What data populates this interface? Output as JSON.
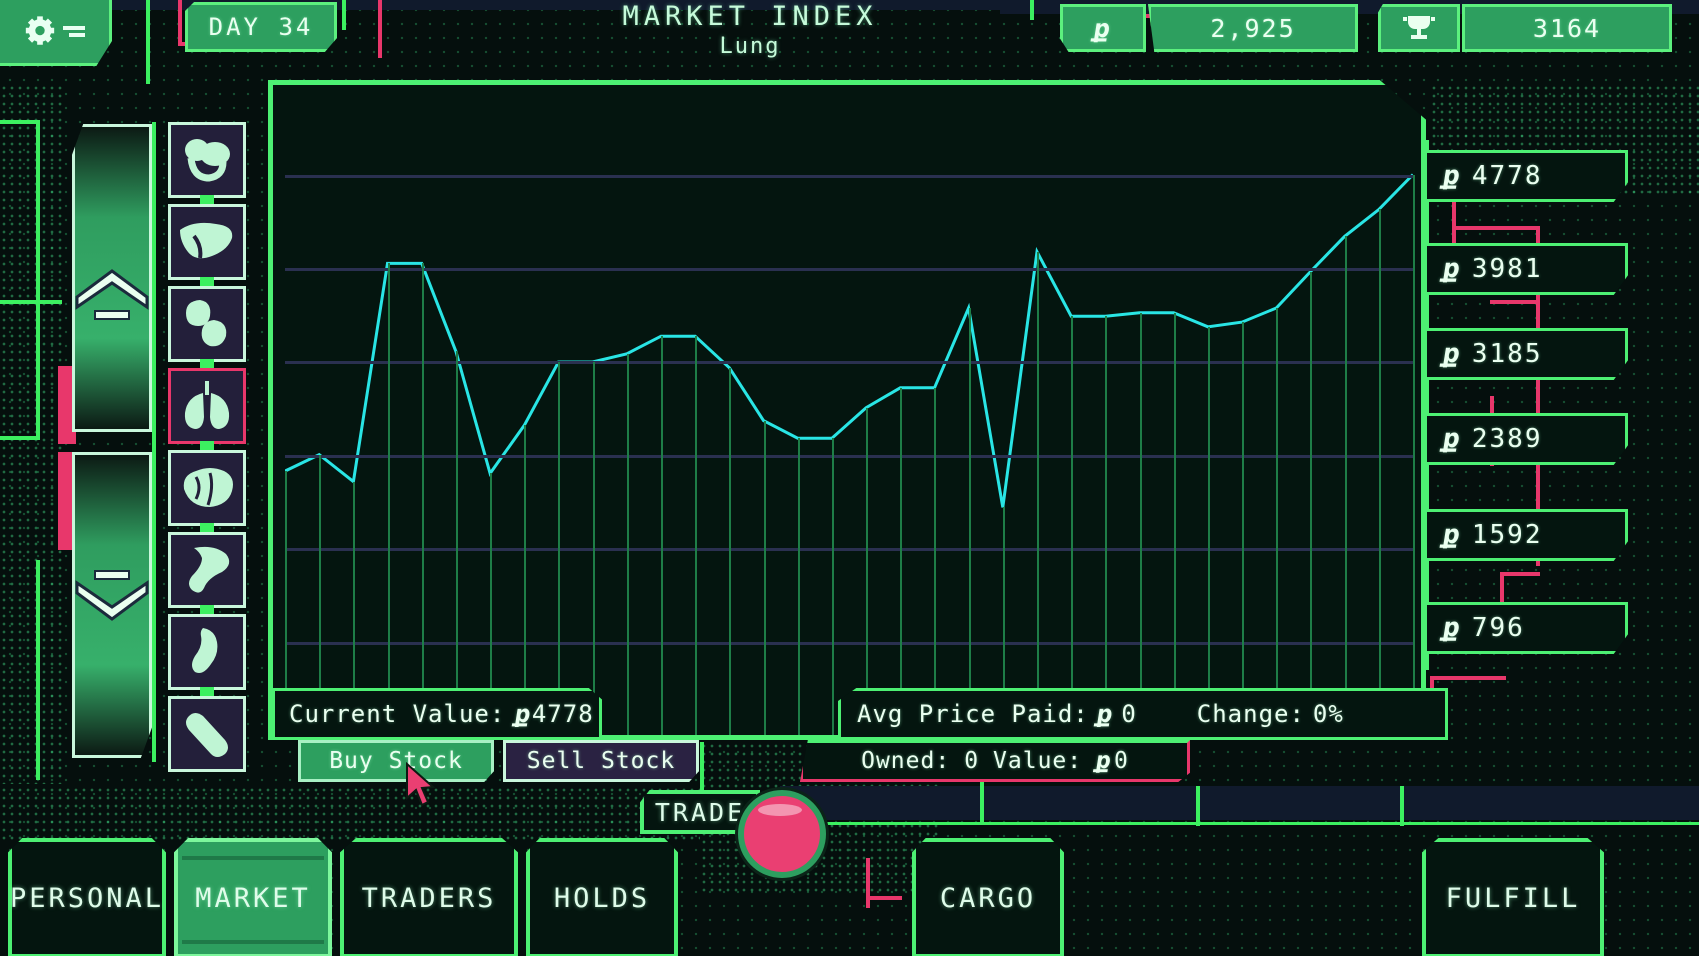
{
  "topbar": {
    "settings_icon": "gear-icon",
    "day_label": "DAY 34",
    "title": "MARKET INDEX",
    "subtitle": "Lung",
    "cash_icon": "currency-glyph",
    "cash_value": "2,925",
    "reputation_icon": "trophy-icon",
    "reputation_value": "3164"
  },
  "sidebar": {
    "scroll_up_icon": "chevron-up-icon",
    "scroll_down_icon": "chevron-down-icon",
    "organs": [
      {
        "name": "heart",
        "selected": false
      },
      {
        "name": "liver",
        "selected": false
      },
      {
        "name": "kidney",
        "selected": false
      },
      {
        "name": "lungs",
        "selected": true
      },
      {
        "name": "brain",
        "selected": false
      },
      {
        "name": "stomach",
        "selected": false
      },
      {
        "name": "pancreas",
        "selected": false
      },
      {
        "name": "bone",
        "selected": false
      }
    ]
  },
  "chart_data": {
    "type": "line",
    "title": "MARKET INDEX",
    "subtitle": "Lung",
    "xlabel": "",
    "ylabel": "",
    "grid": true,
    "legend": false,
    "series_color": "#29e5e5",
    "ytick_labels": [
      "4778",
      "3981",
      "3185",
      "2389",
      "1592",
      "796"
    ],
    "ytick_values": [
      4778,
      3981,
      3185,
      2389,
      1592,
      796
    ],
    "ylim": [
      0,
      5200
    ],
    "x": [
      1,
      2,
      3,
      4,
      5,
      6,
      7,
      8,
      9,
      10,
      11,
      12,
      13,
      14,
      15,
      16,
      17,
      18,
      19,
      20,
      21,
      22,
      23,
      24,
      25,
      26,
      27,
      28,
      29,
      30,
      31,
      32,
      33,
      34
    ],
    "values": [
      2250,
      2390,
      2160,
      4020,
      4020,
      3270,
      2230,
      2640,
      3180,
      3180,
      3250,
      3400,
      3400,
      3130,
      2680,
      2530,
      2530,
      2790,
      2960,
      2960,
      3640,
      1940,
      4120,
      3570,
      3570,
      3600,
      3600,
      3480,
      3520,
      3640,
      3950,
      4250,
      4480,
      4778
    ]
  },
  "readouts": {
    "current_value_label": "Current Value:",
    "current_value": "4778",
    "avg_price_label": "Avg Price Paid:",
    "avg_price": "0",
    "change_label": "Change:",
    "change_value": "0%",
    "owned_label": "Owned:",
    "owned_value": "0",
    "value_label": "Value:",
    "value_amount": "0"
  },
  "actions": {
    "buy_label": "Buy Stock",
    "sell_label": "Sell Stock",
    "trade_label": "TRADE",
    "trade_button_icon": "trade-knob"
  },
  "nav": {
    "tabs": [
      {
        "id": "personal",
        "label": "PERSONAL",
        "active": false
      },
      {
        "id": "market",
        "label": "MARKET",
        "active": true
      },
      {
        "id": "traders",
        "label": "TRADERS",
        "active": false
      },
      {
        "id": "holds",
        "label": "HOLDS",
        "active": false
      },
      {
        "id": "cargo",
        "label": "CARGO",
        "active": false
      },
      {
        "id": "fulfill",
        "label": "FULFILL",
        "active": false
      }
    ]
  },
  "colors": {
    "accent_green": "#4df073",
    "panel_green": "#2d9f5f",
    "accent_pink": "#e8376b",
    "line_cyan": "#29e5e5",
    "bg_dark": "#04150f",
    "grid_line": "#2a3050"
  },
  "currency_symbol": "ք"
}
